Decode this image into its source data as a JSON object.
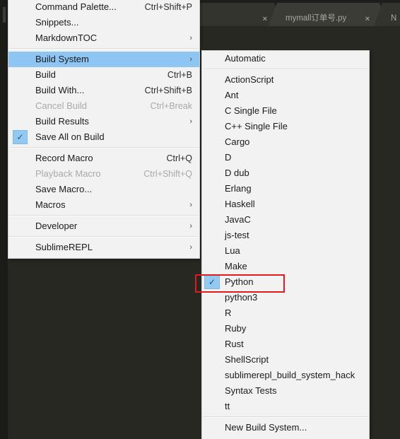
{
  "window": {
    "app": "Sublime Text",
    "background_color": "#272822",
    "tabbar_color": "#1e1f1c"
  },
  "tabs": [
    {
      "label": "",
      "close_label": "×",
      "active": false
    },
    {
      "label": "mymall订单号.py",
      "close_label": "×",
      "active": true
    },
    {
      "label": "N",
      "close_label": "",
      "active": false
    }
  ],
  "main_menu": {
    "name": "tools-menu",
    "items": [
      {
        "type": "item",
        "label": "Command Palette...",
        "shortcut": "Ctrl+Shift+P",
        "arrow": false,
        "checked": false,
        "disabled": false,
        "selected": false
      },
      {
        "type": "item",
        "label": "Snippets...",
        "shortcut": "",
        "arrow": false,
        "checked": false,
        "disabled": false,
        "selected": false
      },
      {
        "type": "item",
        "label": "MarkdownTOC",
        "shortcut": "",
        "arrow": true,
        "checked": false,
        "disabled": false,
        "selected": false
      },
      {
        "type": "separator"
      },
      {
        "type": "item",
        "label": "Build System",
        "shortcut": "",
        "arrow": true,
        "checked": false,
        "disabled": false,
        "selected": true
      },
      {
        "type": "item",
        "label": "Build",
        "shortcut": "Ctrl+B",
        "arrow": false,
        "checked": false,
        "disabled": false,
        "selected": false
      },
      {
        "type": "item",
        "label": "Build With...",
        "shortcut": "Ctrl+Shift+B",
        "arrow": false,
        "checked": false,
        "disabled": false,
        "selected": false
      },
      {
        "type": "item",
        "label": "Cancel Build",
        "shortcut": "Ctrl+Break",
        "arrow": false,
        "checked": false,
        "disabled": true,
        "selected": false
      },
      {
        "type": "item",
        "label": "Build Results",
        "shortcut": "",
        "arrow": true,
        "checked": false,
        "disabled": false,
        "selected": false
      },
      {
        "type": "item",
        "label": "Save All on Build",
        "shortcut": "",
        "arrow": false,
        "checked": true,
        "disabled": false,
        "selected": false
      },
      {
        "type": "separator"
      },
      {
        "type": "item",
        "label": "Record Macro",
        "shortcut": "Ctrl+Q",
        "arrow": false,
        "checked": false,
        "disabled": false,
        "selected": false
      },
      {
        "type": "item",
        "label": "Playback Macro",
        "shortcut": "Ctrl+Shift+Q",
        "arrow": false,
        "checked": false,
        "disabled": true,
        "selected": false
      },
      {
        "type": "item",
        "label": "Save Macro...",
        "shortcut": "",
        "arrow": false,
        "checked": false,
        "disabled": false,
        "selected": false
      },
      {
        "type": "item",
        "label": "Macros",
        "shortcut": "",
        "arrow": true,
        "checked": false,
        "disabled": false,
        "selected": false
      },
      {
        "type": "separator"
      },
      {
        "type": "item",
        "label": "Developer",
        "shortcut": "",
        "arrow": true,
        "checked": false,
        "disabled": false,
        "selected": false
      },
      {
        "type": "separator"
      },
      {
        "type": "item",
        "label": "SublimeREPL",
        "shortcut": "",
        "arrow": true,
        "checked": false,
        "disabled": false,
        "selected": false
      }
    ]
  },
  "sub_menu": {
    "name": "build-system-submenu",
    "items": [
      {
        "type": "item",
        "label": "Automatic",
        "checked": false
      },
      {
        "type": "separator"
      },
      {
        "type": "item",
        "label": "ActionScript",
        "checked": false
      },
      {
        "type": "item",
        "label": "Ant",
        "checked": false
      },
      {
        "type": "item",
        "label": "C Single File",
        "checked": false
      },
      {
        "type": "item",
        "label": "C++ Single File",
        "checked": false
      },
      {
        "type": "item",
        "label": "Cargo",
        "checked": false
      },
      {
        "type": "item",
        "label": "D",
        "checked": false
      },
      {
        "type": "item",
        "label": "D dub",
        "checked": false
      },
      {
        "type": "item",
        "label": "Erlang",
        "checked": false
      },
      {
        "type": "item",
        "label": "Haskell",
        "checked": false
      },
      {
        "type": "item",
        "label": "JavaC",
        "checked": false
      },
      {
        "type": "item",
        "label": "js-test",
        "checked": false
      },
      {
        "type": "item",
        "label": "Lua",
        "checked": false
      },
      {
        "type": "item",
        "label": "Make",
        "checked": false
      },
      {
        "type": "item",
        "label": "Python",
        "checked": true
      },
      {
        "type": "item",
        "label": "python3",
        "checked": false
      },
      {
        "type": "item",
        "label": "R",
        "checked": false
      },
      {
        "type": "item",
        "label": "Ruby",
        "checked": false
      },
      {
        "type": "item",
        "label": "Rust",
        "checked": false
      },
      {
        "type": "item",
        "label": "ShellScript",
        "checked": false
      },
      {
        "type": "item",
        "label": "sublimerepl_build_system_hack",
        "checked": false
      },
      {
        "type": "item",
        "label": "Syntax Tests",
        "checked": false
      },
      {
        "type": "item",
        "label": "tt",
        "checked": false
      },
      {
        "type": "separator"
      },
      {
        "type": "item",
        "label": "New Build System...",
        "checked": false
      }
    ]
  },
  "icons": {
    "checkmark": "✓",
    "submenu_arrow": "›",
    "close": "×"
  },
  "annotation": {
    "name": "python-highlight-box",
    "color": "#e11b1b",
    "target": "Python"
  }
}
